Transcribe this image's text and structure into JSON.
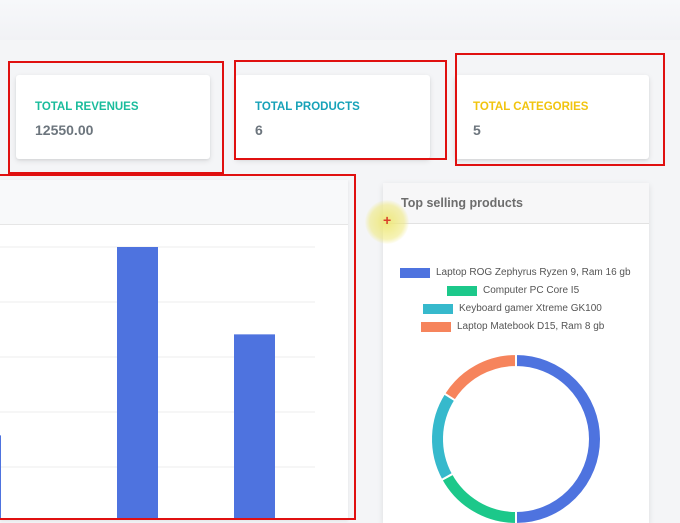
{
  "stats": [
    {
      "label": "TOTAL REVENUES",
      "value": "12550.00",
      "color": "#1abc9c"
    },
    {
      "label": "TOTAL PRODUCTS",
      "value": "6",
      "color": "#17a2b8"
    },
    {
      "label": "TOTAL CATEGORIES",
      "value": "5",
      "color": "#f1c40f"
    }
  ],
  "top_selling": {
    "title": "Top selling products",
    "legend": [
      {
        "label": "Laptop ROG Zephyrus Ryzen 9, Ram 16 gb",
        "color": "#4e73df"
      },
      {
        "label": "Computer PC Core I5",
        "color": "#1cc88a"
      },
      {
        "label": "Keyboard gamer Xtreme GK100",
        "color": "#36b9cc"
      },
      {
        "label": "Laptop Matebook D15, Ram 8 gb",
        "color": "#f6845c"
      }
    ]
  },
  "colors": {
    "highlight": "#e01010",
    "bar": "#4e73df"
  },
  "chart_data": [
    {
      "type": "bar",
      "values": [
        31,
        100,
        68
      ],
      "ylim": [
        0,
        100
      ],
      "grid": true
    },
    {
      "type": "pie",
      "title": "Top selling products",
      "categories": [
        "Laptop ROG Zephyrus Ryzen 9, Ram 16 gb",
        "Computer PC Core I5",
        "Keyboard gamer Xtreme GK100",
        "Laptop Matebook D15, Ram 8 gb"
      ],
      "values": [
        50,
        17,
        17,
        16
      ],
      "colors": [
        "#4e73df",
        "#1cc88a",
        "#36b9cc",
        "#f6845c"
      ],
      "legend": "top"
    }
  ]
}
